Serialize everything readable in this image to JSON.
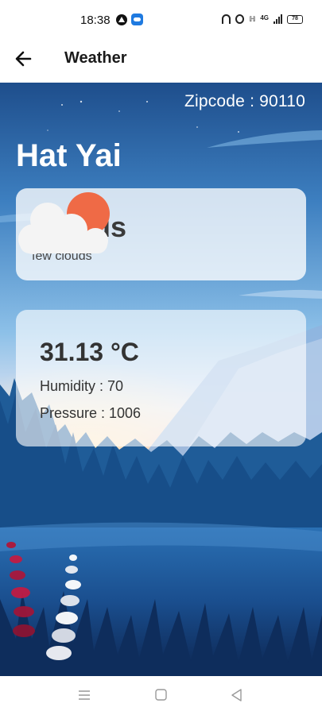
{
  "status_bar": {
    "time": "18:38",
    "network": "4G",
    "battery": "78"
  },
  "app_bar": {
    "title": "Weather",
    "back_icon": "arrow-left-icon"
  },
  "weather": {
    "zipcode": "Zipcode : 90110",
    "city": "Hat Yai",
    "condition": "Clouds",
    "description": "few clouds",
    "condition_icon": "sun-behind-cloud-icon",
    "temperature": "31.13 °C",
    "humidity": "Humidity : 70",
    "pressure": "Pressure : 1006"
  },
  "nav_bar": {
    "icons": [
      "menu-icon",
      "home-square-icon",
      "back-triangle-icon"
    ]
  },
  "colors": {
    "sun": "#EF6A46",
    "sky_top": "#1E4E8C",
    "sky_mid": "#5FA3D8",
    "horizon": "#F6C3C9",
    "forest": "#123E73"
  }
}
